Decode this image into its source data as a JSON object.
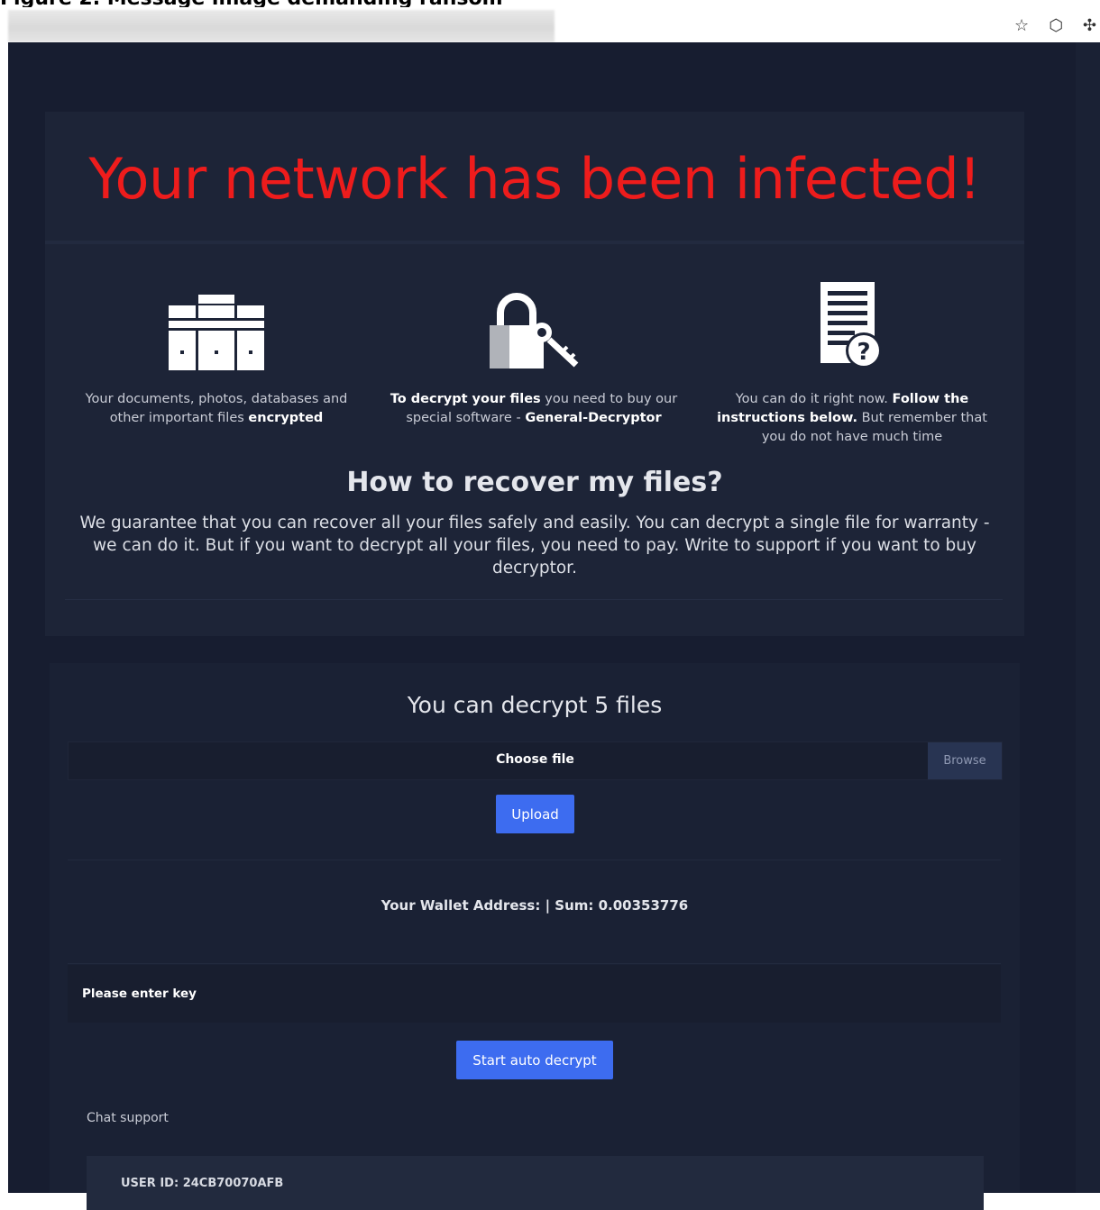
{
  "caption": "Figure 2. Message image demanding ransom",
  "browser": {
    "star_icon": "star-outline-icon",
    "shield_icon": "shield-outline-icon",
    "extension_icon": "puzzle-icon"
  },
  "main": {
    "headline": "Your network has been infected!",
    "features": [
      {
        "icon": "server-racks-icon",
        "text_plain": "Your documents, photos, databases and other important files ",
        "text_bold": "encrypted"
      },
      {
        "icon": "padlock-key-icon",
        "text_bold_lead": "To decrypt your files",
        "text_plain": " you need to buy our special software - ",
        "text_bold_tail": "General-Decryptor"
      },
      {
        "icon": "document-question-icon",
        "text_plain_lead": "You can do it right now. ",
        "text_bold": "Follow the instructions below.",
        "text_plain_tail": " But remember that you do not have much time"
      }
    ],
    "how_title": "How to recover my files?",
    "how_text": "We guarantee that you can recover all your files safely and easily. You can decrypt a single file for warranty - we can do it. But if you want to decrypt all your files, you need to pay. Write to support if you want to buy decryptor."
  },
  "decrypt": {
    "title": "You can decrypt 5 files",
    "choose_file": "Choose file",
    "browse": "Browse",
    "upload": "Upload",
    "wallet": "Your Wallet Address: | Sum: 0.00353776",
    "key_placeholder": "Please enter key",
    "start_decrypt": "Start auto decrypt",
    "chat_label": "Chat support",
    "user_id": "USER ID: 24CB70070AFB"
  },
  "colors": {
    "page_bg": "#171d30",
    "headline": "#ee1c1c",
    "button": "#3d6cf0"
  }
}
